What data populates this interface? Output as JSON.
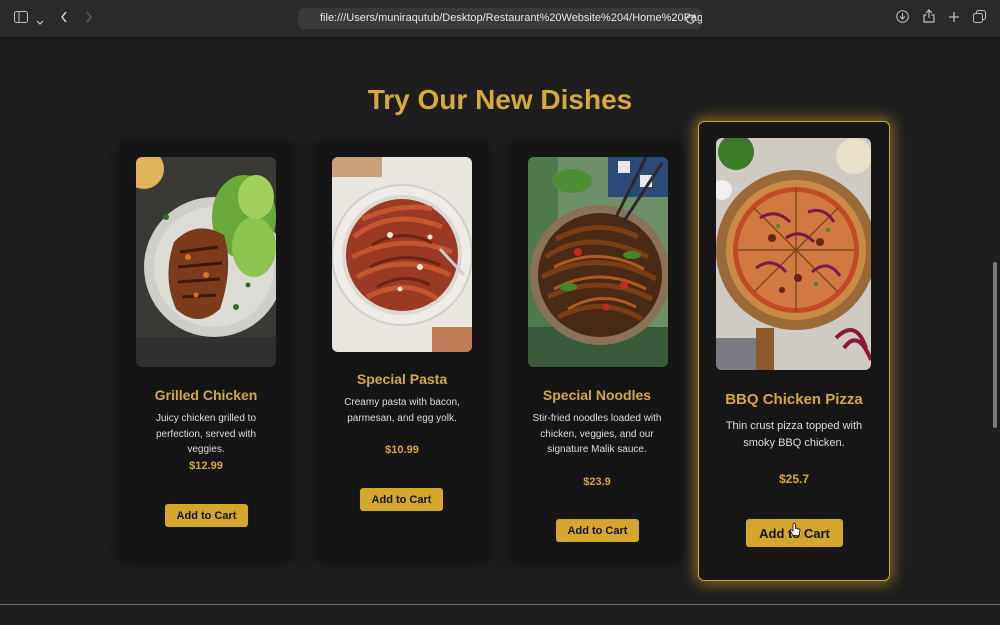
{
  "browser": {
    "url": "file:///Users/muniraqutub/Desktop/Restaurant%20Website%204/Home%20Page.html",
    "icons": [
      "sidebar-icon",
      "chevron-down-icon",
      "back-icon",
      "forward-icon",
      "reload-icon",
      "download-icon",
      "share-icon",
      "new-tab-icon",
      "tab-overview-icon"
    ]
  },
  "section": {
    "title": "Try Our New Dishes"
  },
  "accent_color": "#d6a93b",
  "dishes": [
    {
      "name": "Grilled Chicken",
      "description": "Juicy chicken grilled to perfection, served with veggies.",
      "price": "$12.99",
      "button": "Add to Cart"
    },
    {
      "name": "Special Pasta",
      "description": "Creamy pasta with bacon, parmesan, and egg yolk.",
      "price": "$10.99",
      "button": "Add to Cart"
    },
    {
      "name": "Special Noodles",
      "description": "Stir-fried noodles loaded with chicken, veggies, and our signature Malik sauce.",
      "price": "$23.9",
      "button": "Add to Cart"
    },
    {
      "name": "BBQ Chicken Pizza",
      "description": "Thin crust pizza topped with smoky BBQ chicken.",
      "price": "$25.7",
      "button": "Add to Cart"
    }
  ]
}
